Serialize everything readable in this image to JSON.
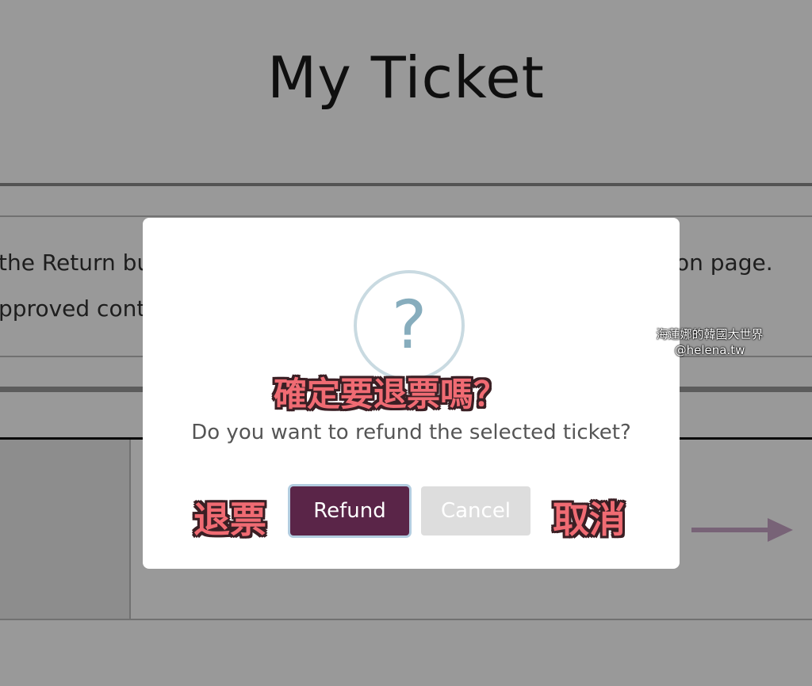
{
  "page": {
    "title": "My Ticket",
    "info_lines": [
      "the Return but",
      "pproved conter",
      "on page."
    ]
  },
  "dialog": {
    "icon": "question-icon",
    "question_mark": "?",
    "message": "Do you want to refund the selected ticket?",
    "refund_label": "Refund",
    "cancel_label": "Cancel"
  },
  "annotations": {
    "question_zh": "確定要退票嗎？",
    "refund_zh": "退票",
    "cancel_zh": "取消"
  },
  "watermark": {
    "line1": "海蓮娜的韓國大世界",
    "line2": "@helena.tw"
  },
  "colors": {
    "refund_button": "#5a2548",
    "cancel_button": "#dddddd",
    "annotation": "#f06b73",
    "icon": "#87adbd"
  }
}
